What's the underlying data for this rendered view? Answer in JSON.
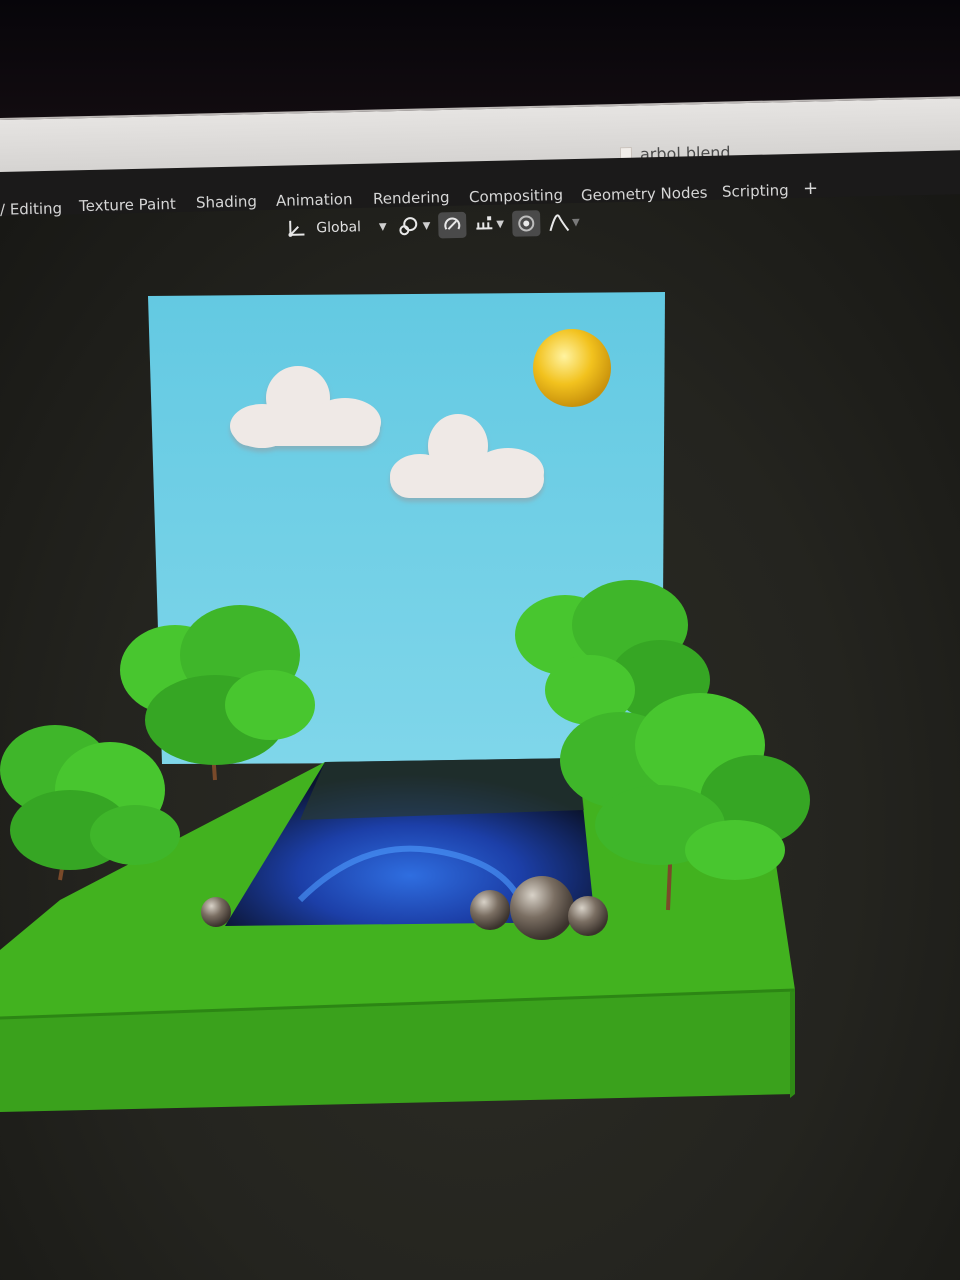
{
  "window": {
    "file_title": "arbol.blend"
  },
  "workspace_tabs": [
    {
      "label": "/ Editing"
    },
    {
      "label": "Texture Paint"
    },
    {
      "label": "Shading"
    },
    {
      "label": "Animation"
    },
    {
      "label": "Rendering"
    },
    {
      "label": "Compositing"
    },
    {
      "label": "Geometry Nodes"
    },
    {
      "label": "Scripting"
    },
    {
      "label": "+"
    }
  ],
  "header_tools": {
    "transform_orientation": "Global",
    "icons": [
      "transform-orientation-icon",
      "pivot-point-icon",
      "snap-icon",
      "snap-increment-icon",
      "proportional-edit-icon",
      "falloff-curve-icon"
    ]
  },
  "colors": {
    "sky": "#6fd0e6",
    "grass": "#3aa11c",
    "sun": "#f2c21e",
    "ui_bar": "#1b1a1a",
    "viewport": "#2a2a24"
  }
}
